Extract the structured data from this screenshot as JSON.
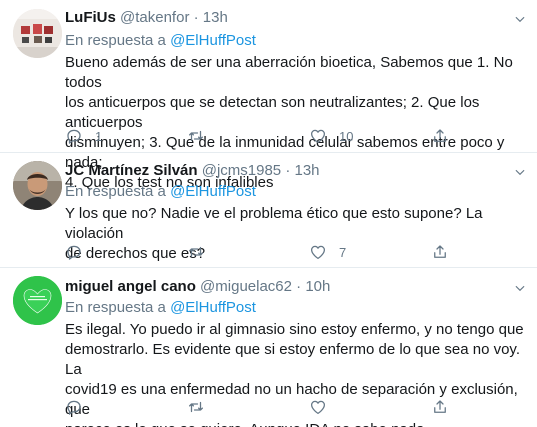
{
  "reply_prefix": "En respuesta a",
  "tweets": [
    {
      "name": "LuFiUs",
      "handle": "@takenfor",
      "time": "13h",
      "reply_to": "@ElHuffPost",
      "text": "Bueno además de ser una aberración bioetica, Sabemos que 1. No todos\nlos anticuerpos que se detectan son neutralizantes; 2. Que los anticuerpos\ndisminuyen; 3. Que de la inmunidad celular sabemos entre poco y nada;\n4. Que los test no son infalibles",
      "replies": "1",
      "retweets": "",
      "likes": "10"
    },
    {
      "name": "JC Martínez Silván",
      "handle": "@jcms1985",
      "time": "13h",
      "reply_to": "@ElHuffPost",
      "text": "Y los que no? Nadie ve el problema ético que esto supone? La violación\nde derechos que es?",
      "replies": "",
      "retweets": "",
      "likes": "7"
    },
    {
      "name": "miguel angel cano",
      "handle": "@miguelac62",
      "time": "10h",
      "reply_to": "@ElHuffPost",
      "text": "Es ilegal. Yo puedo ir al gimnasio sino estoy enfermo, y no tengo que\ndemostrarlo. Es evidente que si estoy enfermo de lo que sea no voy. La\ncovid19 es una enfermedad no un hacho de separación y exclusión, que\nparece es lo que se quiere. Aunque IDA no sabe nada.",
      "replies": "",
      "retweets": "",
      "likes": ""
    }
  ],
  "colors": {
    "link": "#1b95e0",
    "muted": "#657786",
    "text": "#14171a",
    "divider": "#e6ecf0",
    "avatar_green": "#2fc34a"
  },
  "icons": [
    "reply-icon",
    "retweet-icon",
    "like-icon",
    "share-icon",
    "chevron-down-icon"
  ]
}
